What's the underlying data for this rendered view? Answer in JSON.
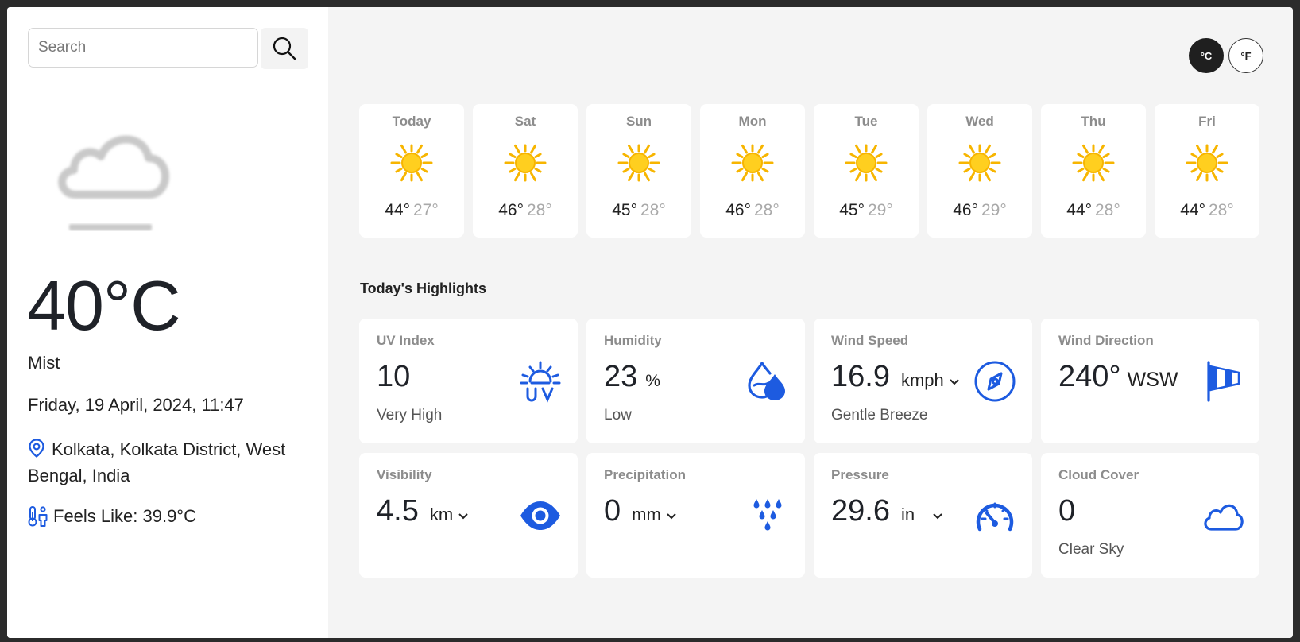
{
  "search": {
    "placeholder": "Search"
  },
  "current": {
    "icon": "mist-icon",
    "temperature": "40°C",
    "condition": "Mist",
    "datetime": "Friday, 19 April, 2024, 11:47",
    "location": "Kolkata, Kolkata District, West Bengal, India",
    "feels_like": "Feels Like: 39.9°C"
  },
  "units": {
    "celsius": "°C",
    "fahrenheit": "°F",
    "active": "celsius"
  },
  "forecast": [
    {
      "day": "Today",
      "hi": "44°",
      "lo": "27°",
      "icon": "sun-icon"
    },
    {
      "day": "Sat",
      "hi": "46°",
      "lo": "28°",
      "icon": "sun-icon"
    },
    {
      "day": "Sun",
      "hi": "45°",
      "lo": "28°",
      "icon": "sun-icon"
    },
    {
      "day": "Mon",
      "hi": "46°",
      "lo": "28°",
      "icon": "sun-icon"
    },
    {
      "day": "Tue",
      "hi": "45°",
      "lo": "29°",
      "icon": "sun-icon"
    },
    {
      "day": "Wed",
      "hi": "46°",
      "lo": "29°",
      "icon": "sun-icon"
    },
    {
      "day": "Thu",
      "hi": "44°",
      "lo": "28°",
      "icon": "sun-icon"
    },
    {
      "day": "Fri",
      "hi": "44°",
      "lo": "28°",
      "icon": "sun-icon"
    }
  ],
  "highlights_title": "Today's Highlights",
  "highlights": {
    "uv": {
      "label": "UV Index",
      "value": "10",
      "sub": "Very High",
      "icon": "uv-icon"
    },
    "humidity": {
      "label": "Humidity",
      "value": "23",
      "unit": "%",
      "sub": "Low",
      "icon": "humidity-icon"
    },
    "wind_speed": {
      "label": "Wind Speed",
      "value": "16.9",
      "unit": "kmph",
      "sub": "Gentle Breeze",
      "icon": "compass-icon"
    },
    "wind_direction": {
      "label": "Wind Direction",
      "value": "240°",
      "unit": "WSW",
      "icon": "windsock-icon"
    },
    "visibility": {
      "label": "Visibility",
      "value": "4.5",
      "unit": "km",
      "icon": "eye-icon"
    },
    "precipitation": {
      "label": "Precipitation",
      "value": "0",
      "unit": "mm",
      "icon": "rain-drops-icon"
    },
    "pressure": {
      "label": "Pressure",
      "value": "29.6",
      "unit": "in",
      "icon": "gauge-icon"
    },
    "cloud_cover": {
      "label": "Cloud Cover",
      "value": "0",
      "sub": "Clear Sky",
      "icon": "cloud-icon"
    }
  },
  "colors": {
    "accent": "#1d5be0",
    "sun": "#f7b500",
    "sun_core": "#ffcf1f"
  }
}
